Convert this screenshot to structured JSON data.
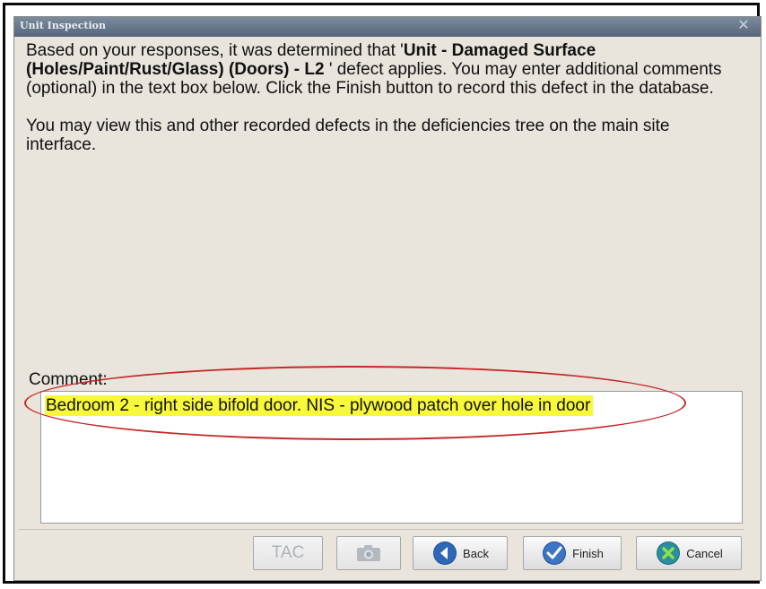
{
  "dialog": {
    "title": "Unit Inspection",
    "close_icon": "close-icon"
  },
  "message": {
    "intro_before": "Based on your responses, it was determined that '",
    "defect_name": "Unit - Damaged Surface (Holes/Paint/Rust/Glass) (Doors) - L2",
    "intro_after": " ' defect applies. You may enter additional comments (optional) in the text box below. Click the Finish button to record this defect in the database.",
    "view_info": "You may view this and other recorded defects in the deficiencies tree on the main site interface."
  },
  "comment": {
    "label": "Comment:",
    "value": "Bedroom 2 - right side bifold door. NIS - plywood patch over hole in door"
  },
  "buttons": {
    "tac": "TAC",
    "camera_icon": "camera-icon",
    "back": "Back",
    "finish": "Finish",
    "cancel": "Cancel"
  },
  "colors": {
    "highlight": "#f8f83a",
    "annotation": "#c62828",
    "titlebar": "#56657a"
  }
}
